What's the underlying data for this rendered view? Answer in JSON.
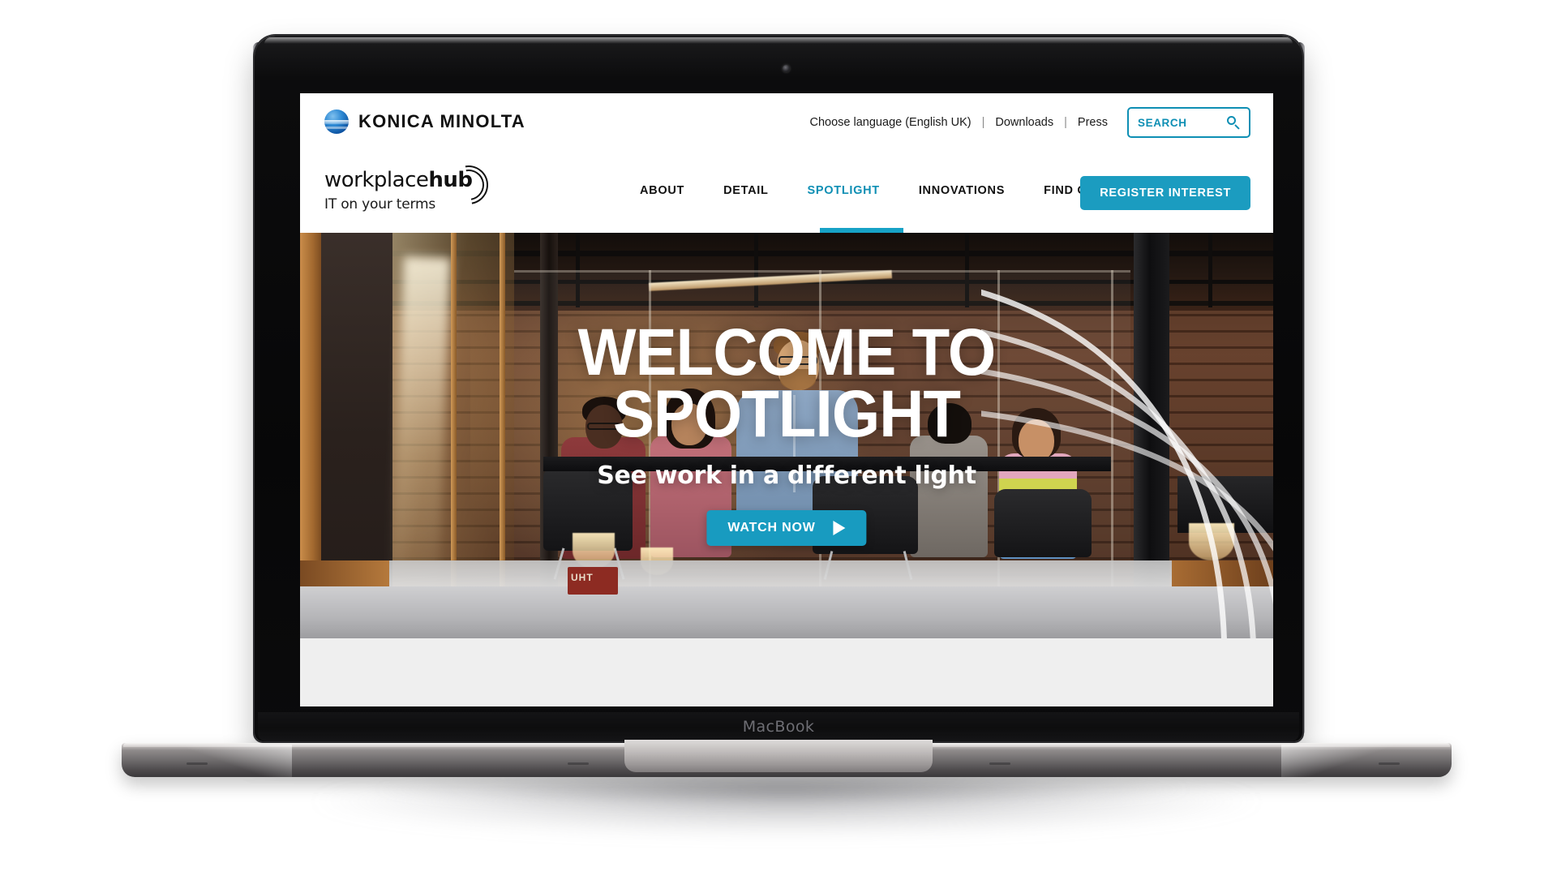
{
  "device": {
    "brand_label": "MacBook"
  },
  "browser": {
    "utility_bar": {
      "brand": {
        "name": "KONICA MINOLTA",
        "logo_icon": "konica-minolta-globe-icon",
        "accent": "#0b4f9e"
      },
      "links": [
        {
          "label": "Choose language (English UK)"
        },
        {
          "label": "Downloads"
        },
        {
          "label": "Press"
        }
      ],
      "separator": "|",
      "search": {
        "placeholder": "SEARCH",
        "value": "",
        "icon": "search-icon",
        "accent": "#0e8fb4"
      }
    },
    "nav_bar": {
      "product_logo": {
        "word_light": "workplace",
        "word_bold": "hub",
        "tagline": "IT on your terms",
        "mark_icon": "hub-arcs-icon"
      },
      "items": [
        {
          "label": "ABOUT",
          "active": false
        },
        {
          "label": "DETAIL",
          "active": false
        },
        {
          "label": "SPOTLIGHT",
          "active": true
        },
        {
          "label": "INNOVATIONS",
          "active": false
        },
        {
          "label": "FIND OUT MORE",
          "active": false
        }
      ],
      "cta": {
        "label": "REGISTER INTEREST",
        "color": "#1b9cc0"
      },
      "active_underline_color": "#17a2c6"
    },
    "hero": {
      "title_line1": "WELCOME TO",
      "title_line2": "SPOTLIGHT",
      "subtitle": "See work in a different light",
      "cta": {
        "label": "WATCH NOW",
        "icon": "play-icon",
        "color": "#189bc0"
      },
      "background_alt": "Team of colleagues talking in a brick-walled glass meeting room",
      "overlay_graphic": "concentric-arcs-graphic",
      "signage_text": "UHT"
    },
    "section_below_hero": {
      "background": "#efefef"
    }
  }
}
